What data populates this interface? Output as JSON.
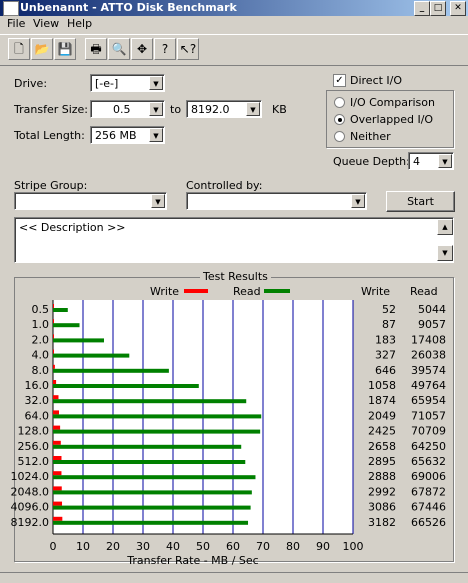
{
  "window": {
    "title": "Unbenannt - ATTO Disk Benchmark",
    "minimize": "_",
    "maximize": "□",
    "close": "✕"
  },
  "menu": [
    "File",
    "View",
    "Help"
  ],
  "toolbar": {
    "icons": [
      "new-document-icon",
      "open-folder-icon",
      "save-icon",
      "print-icon",
      "print-preview-icon",
      "move-icon",
      "help-icon",
      "context-help-icon"
    ],
    "glyphs": [
      "🗋",
      "📂",
      "💾",
      "🖶",
      "🔍",
      "✥",
      "?",
      "↖?"
    ]
  },
  "form": {
    "drive_label": "Drive:",
    "drive_value": "[-e-]",
    "transfer_size_label": "Transfer Size:",
    "transfer_from": "0.5",
    "to_label": "to",
    "transfer_to": "8192.0",
    "kb_label": "KB",
    "total_length_label": "Total Length:",
    "total_length_value": "256 MB",
    "direct_io_label": "Direct I/O",
    "direct_io_checked": true,
    "radios": [
      {
        "label": "I/O Comparison",
        "selected": false
      },
      {
        "label": "Overlapped I/O",
        "selected": true
      },
      {
        "label": "Neither",
        "selected": false
      }
    ],
    "queue_depth_label": "Queue Depth:",
    "queue_depth_value": "4",
    "stripe_group_label": "Stripe Group:",
    "stripe_group_value": "",
    "controlled_by_label": "Controlled by:",
    "controlled_by_value": "",
    "start_label": "Start",
    "description": "<< Description >>"
  },
  "results": {
    "group_title": "Test Results",
    "legend_write": "Write",
    "legend_read": "Read",
    "col_write": "Write",
    "col_read": "Read"
  },
  "chart_data": {
    "type": "bar",
    "orientation": "horizontal",
    "xlabel": "Transfer Rate - MB / Sec",
    "xlim": [
      0,
      100
    ],
    "xticks": [
      "0",
      "10",
      "20",
      "30",
      "40",
      "50",
      "60",
      "70",
      "80",
      "90",
      "100"
    ],
    "categories": [
      "0.5",
      "1.0",
      "2.0",
      "4.0",
      "8.0",
      "16.0",
      "32.0",
      "64.0",
      "128.0",
      "256.0",
      "512.0",
      "1024.0",
      "2048.0",
      "4096.0",
      "8192.0"
    ],
    "series": [
      {
        "name": "Write",
        "color": "#ff0000",
        "values": [
          0.05,
          0.08,
          0.18,
          0.32,
          0.63,
          1.03,
          1.83,
          2.0,
          2.37,
          2.6,
          2.83,
          2.82,
          2.92,
          3.01,
          3.11
        ]
      },
      {
        "name": "Read",
        "color": "#008000",
        "values": [
          4.93,
          8.84,
          17.0,
          25.43,
          38.63,
          48.6,
          64.41,
          69.41,
          69.05,
          62.74,
          64.09,
          67.49,
          66.28,
          65.87,
          65.01
        ]
      }
    ],
    "write_kb": [
      "52",
      "87",
      "183",
      "327",
      "646",
      "1058",
      "1874",
      "2049",
      "2425",
      "2658",
      "2895",
      "2888",
      "2992",
      "3086",
      "3182"
    ],
    "read_kb": [
      "5044",
      "9057",
      "17408",
      "26038",
      "39574",
      "49764",
      "65954",
      "71057",
      "70709",
      "64250",
      "65632",
      "69006",
      "67872",
      "67446",
      "66526"
    ],
    "grid": true
  }
}
